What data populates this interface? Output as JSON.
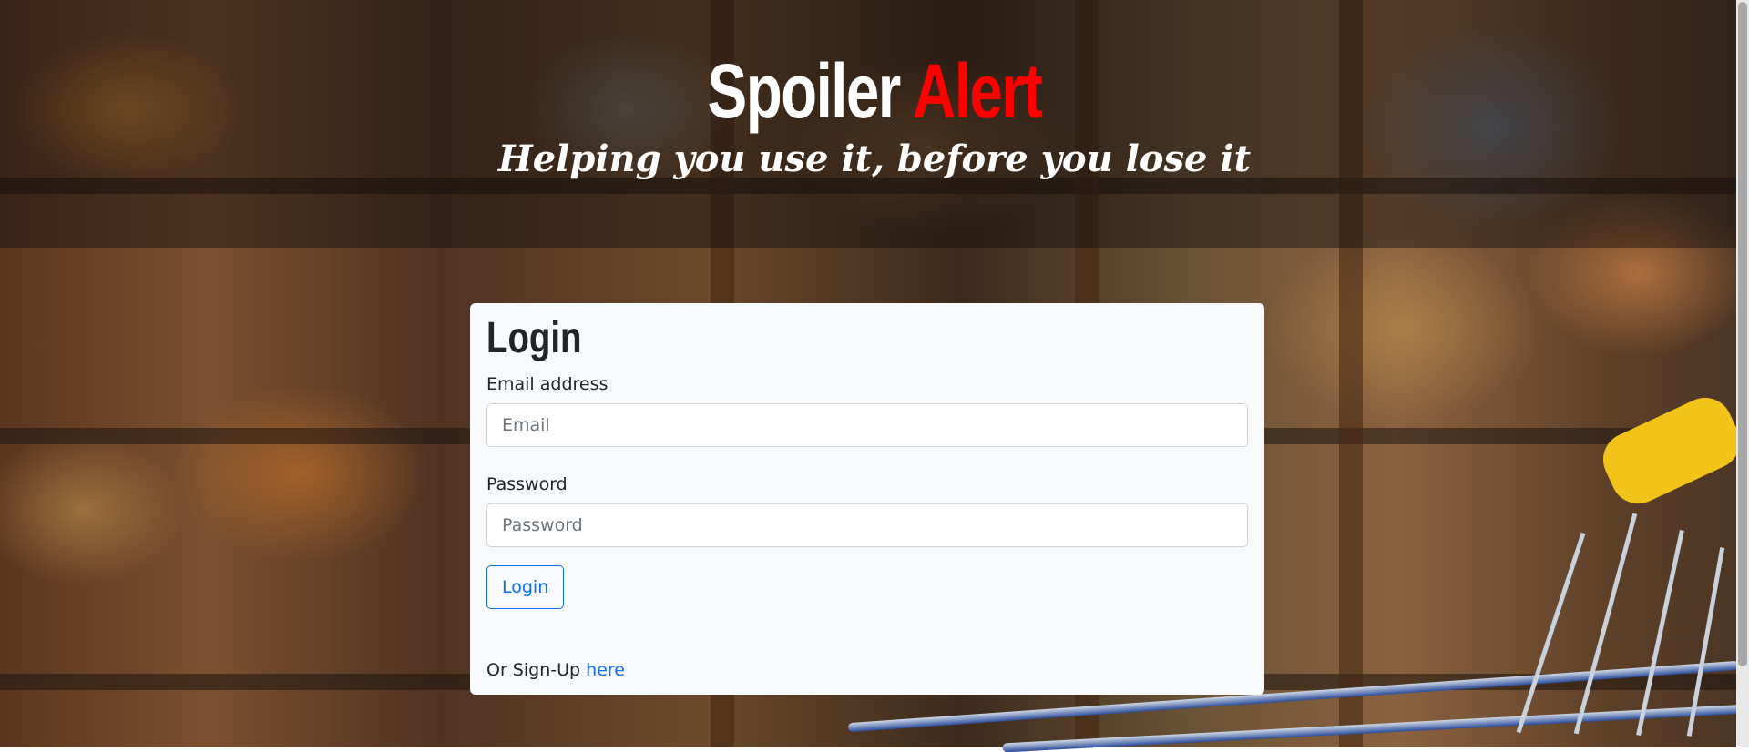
{
  "header": {
    "brand_part1": "Spoiler",
    "brand_part2": "Alert",
    "tagline": "Helping you use it, before you lose it"
  },
  "login_card": {
    "title": "Login",
    "email_label": "Email address",
    "email_placeholder": "Email",
    "password_label": "Password",
    "password_placeholder": "Password",
    "submit_label": "Login",
    "signup_prefix": "Or Sign-Up",
    "signup_link": "here"
  },
  "colors": {
    "brand_accent": "#ff0000",
    "link": "#0d6efd",
    "card_background": "#f8f9fa"
  }
}
